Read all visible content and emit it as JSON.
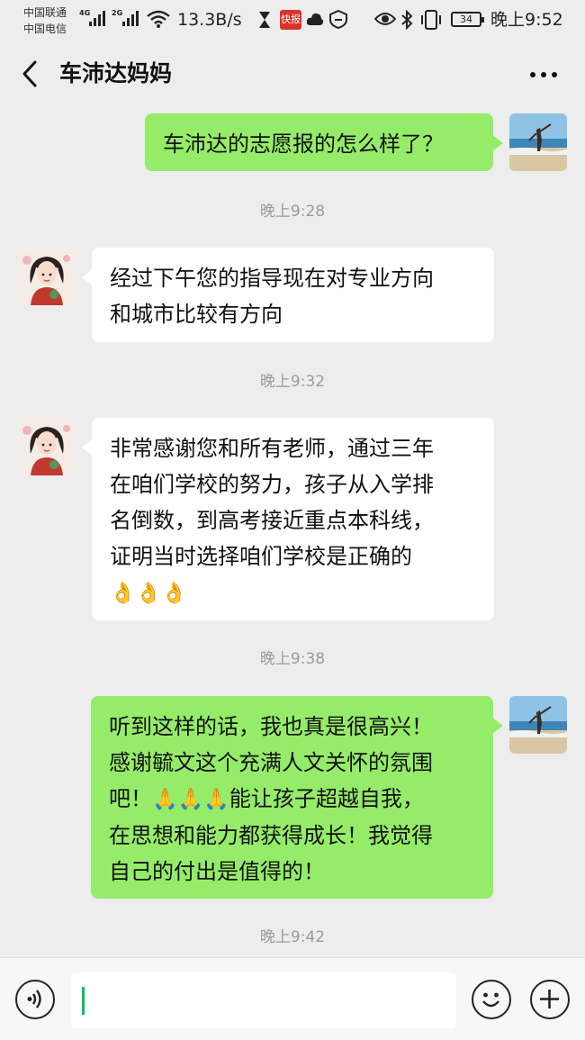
{
  "status_bar": {
    "carrier1": "中国联通",
    "carrier2": "中国电信",
    "network1": "4G",
    "network2": "2G",
    "speed": "13.3B/s",
    "news_badge": "快报",
    "battery": "34",
    "time": "晚上9:52"
  },
  "header": {
    "title": "车沛达妈妈"
  },
  "messages": [
    {
      "sender": "self",
      "text": "车沛达的志愿报的怎么样了？"
    },
    {
      "time": "晚上9:28"
    },
    {
      "sender": "other",
      "lines": [
        "经过下午您的指导现在对专业方向",
        "和城市比较有方向"
      ]
    },
    {
      "time": "晚上9:32"
    },
    {
      "sender": "other",
      "lines": [
        "非常感谢您和所有老师，通过三年",
        "在咱们学校的努力，孩子从入学排",
        "名倒数，到高考接近重点本科线，",
        "证明当时选择咱们学校是正确的"
      ],
      "emoji_line": "👌👌👌"
    },
    {
      "time": "晚上9:38"
    },
    {
      "sender": "self",
      "lines": [
        "听到这样的话，我也真是很高兴！",
        "感谢毓文这个充满人文关怀的氛围",
        "吧！",
        "能让孩子超越自我，",
        "在思想和能力都获得成长！我觉得",
        "自己的付出是值得的！"
      ],
      "inline_emoji": "🙏🙏🙏"
    },
    {
      "time": "晚上9:42"
    }
  ],
  "input_bar": {
    "value": ""
  },
  "colors": {
    "self_bubble": "#95ec69",
    "other_bubble": "#ffffff",
    "background": "#ededed",
    "caret": "#07c160"
  },
  "icons": [
    "back-arrow-icon",
    "more-dots-icon",
    "voice-icon",
    "emoji-icon",
    "plus-icon",
    "wifi-icon",
    "bluetooth-icon",
    "eye-icon",
    "vibrate-icon",
    "hourglass-icon",
    "cloud-icon"
  ]
}
